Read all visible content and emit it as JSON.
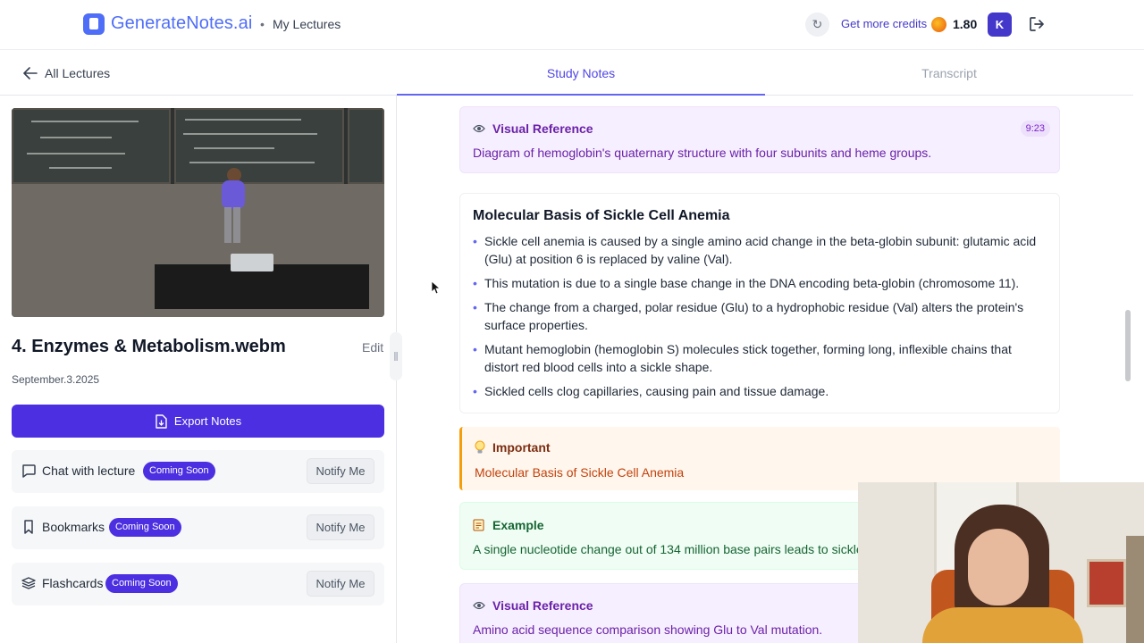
{
  "header": {
    "logo_text": "GenerateNotes.ai",
    "separator": "•",
    "breadcrumb": "My Lectures",
    "credits_link": "Get more credits",
    "credits_value": "1.80",
    "avatar_initial": "K",
    "icons": [
      "logo-icon",
      "refresh-icon",
      "coin-icon",
      "logout-icon"
    ]
  },
  "subheader": {
    "back_label": "All Lectures",
    "tabs": [
      {
        "label": "Study Notes",
        "active": true
      },
      {
        "label": "Transcript",
        "active": false
      }
    ]
  },
  "lecture": {
    "title": "4. Enzymes & Metabolism.webm",
    "edit_label": "Edit",
    "date": "September.3.2025",
    "export_label": "Export Notes",
    "features": [
      {
        "label": "Chat with lecture",
        "badge": "Coming Soon",
        "action": "Notify Me",
        "icon": "chat-icon"
      },
      {
        "label": "Bookmarks",
        "badge": "Coming Soon",
        "action": "Notify Me",
        "icon": "bookmark-icon"
      },
      {
        "label": "Flashcards",
        "badge": "Coming Soon",
        "action": "Notify Me",
        "icon": "flashcards-icon"
      }
    ]
  },
  "notes": {
    "visual_ref_1": {
      "title": "Visual Reference",
      "timestamp": "9:23",
      "text": "Diagram of hemoglobin's quaternary structure with four subunits and heme groups."
    },
    "section": {
      "title": "Molecular Basis of Sickle Cell Anemia",
      "bullets": [
        "Sickle cell anemia is caused by a single amino acid change in the beta-globin subunit: glutamic acid (Glu) at position 6 is replaced by valine (Val).",
        "This mutation is due to a single base change in the DNA encoding beta-globin (chromosome 11).",
        "The change from a charged, polar residue (Glu) to a hydrophobic residue (Val) alters the protein's surface properties.",
        "Mutant hemoglobin (hemoglobin S) molecules stick together, forming long, inflexible chains that distort red blood cells into a sickle shape.",
        "Sickled cells clog capillaries, causing pain and tissue damage."
      ]
    },
    "important": {
      "title": "Important",
      "text": "Molecular Basis of Sickle Cell Anemia"
    },
    "example": {
      "title": "Example",
      "text": "A single nucleotide change out of 134 million base pairs leads to sickle c"
    },
    "visual_ref_2": {
      "title": "Visual Reference",
      "text": "Amino acid sequence comparison showing Glu to Val mutation."
    }
  },
  "colors": {
    "brand": "#4f6ef7",
    "primary_button": "#4c2fe0",
    "active_tab": "#4f46e5",
    "visual_ref_bg": "#f6efff",
    "important_bg": "#fff7ed",
    "example_bg": "#f0fdf4"
  }
}
